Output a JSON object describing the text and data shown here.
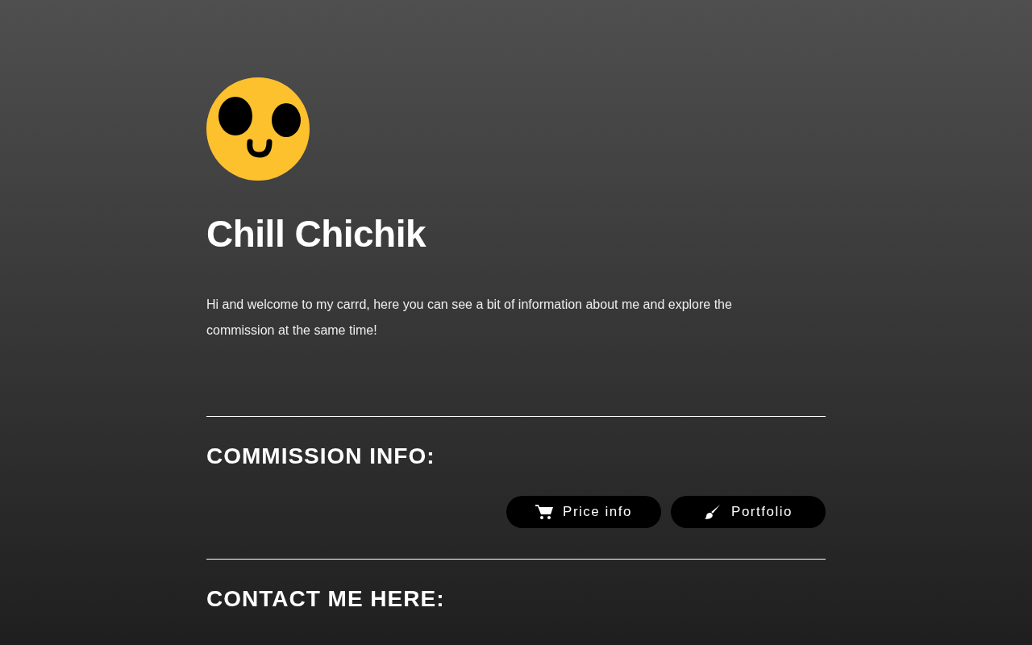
{
  "profile": {
    "name": "Chill Chichik",
    "intro": "Hi and welcome to my carrd, here you can see a bit of information about me and explore the commission at the same time!"
  },
  "sections": [
    {
      "heading": "COMMISSION INFO:",
      "buttons": [
        {
          "label": "Price info",
          "kind": "cart"
        },
        {
          "label": "Portfolio",
          "kind": "brush"
        }
      ]
    },
    {
      "heading": "CONTACT ME HERE:"
    }
  ]
}
